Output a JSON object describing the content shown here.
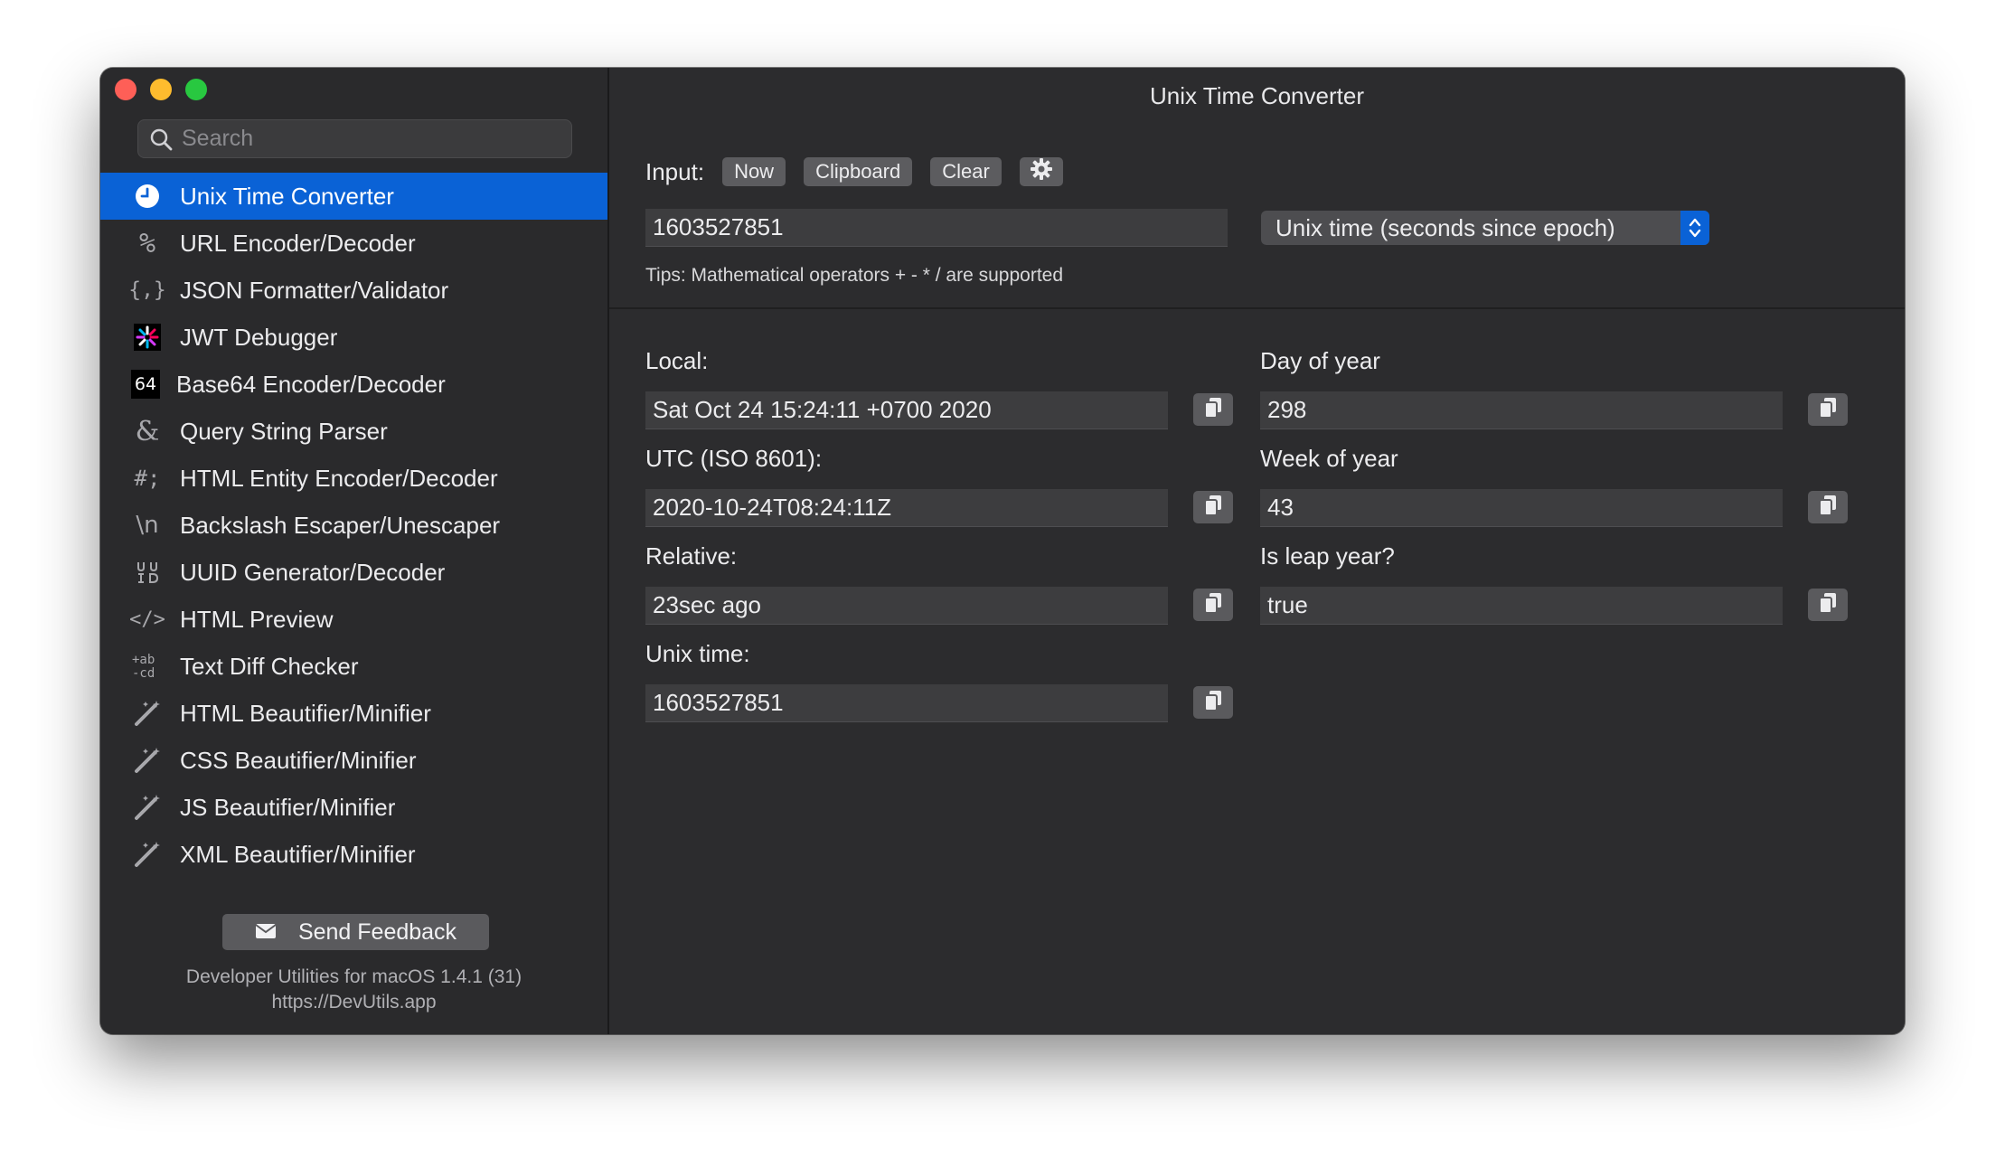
{
  "window": {
    "title": "Unix Time Converter"
  },
  "sidebar": {
    "search_placeholder": "Search",
    "items": [
      {
        "label": "Unix Time Converter",
        "icon": "clock-icon",
        "glyph": ""
      },
      {
        "label": "URL Encoder/Decoder",
        "icon": "percent-icon",
        "glyph": "%"
      },
      {
        "label": "JSON Formatter/Validator",
        "icon": "braces-icon",
        "glyph": "{,}"
      },
      {
        "label": "JWT Debugger",
        "icon": "jwt-icon",
        "glyph": ""
      },
      {
        "label": "Base64 Encoder/Decoder",
        "icon": "base64-icon",
        "glyph": "64"
      },
      {
        "label": "Query String Parser",
        "icon": "ampersand-icon",
        "glyph": "&"
      },
      {
        "label": "HTML Entity Encoder/Decoder",
        "icon": "hash-icon",
        "glyph": "#;"
      },
      {
        "label": "Backslash Escaper/Unescaper",
        "icon": "backslash-n-icon",
        "glyph": "\\n"
      },
      {
        "label": "UUID Generator/Decoder",
        "icon": "uuid-icon",
        "glyph": ""
      },
      {
        "label": "HTML Preview",
        "icon": "code-icon",
        "glyph": "</>"
      },
      {
        "label": "Text Diff Checker",
        "icon": "diff-icon",
        "glyph": ""
      },
      {
        "label": "HTML Beautifier/Minifier",
        "icon": "magic-wand-icon",
        "glyph": ""
      },
      {
        "label": "CSS Beautifier/Minifier",
        "icon": "magic-wand-icon",
        "glyph": ""
      },
      {
        "label": "JS Beautifier/Minifier",
        "icon": "magic-wand-icon",
        "glyph": ""
      },
      {
        "label": "XML Beautifier/Minifier",
        "icon": "magic-wand-icon",
        "glyph": ""
      }
    ],
    "feedback_label": "Send Feedback",
    "version_line1": "Developer Utilities for macOS 1.4.1 (31)",
    "version_line2": "https://DevUtils.app"
  },
  "input": {
    "label": "Input:",
    "buttons": {
      "now": "Now",
      "clipboard": "Clipboard",
      "clear": "Clear"
    },
    "value": "1603527851",
    "format_selected": "Unix time (seconds since epoch)",
    "tips": "Tips: Mathematical operators + - * / are supported"
  },
  "results": {
    "local": {
      "label": "Local:",
      "value": "Sat Oct 24 15:24:11 +0700 2020"
    },
    "utc": {
      "label": "UTC (ISO 8601):",
      "value": "2020-10-24T08:24:11Z"
    },
    "relative": {
      "label": "Relative:",
      "value": "23sec ago"
    },
    "unix": {
      "label": "Unix time:",
      "value": "1603527851"
    },
    "day_of_year": {
      "label": "Day of year",
      "value": "298"
    },
    "week_of_year": {
      "label": "Week of year",
      "value": "43"
    },
    "leap_year": {
      "label": "Is leap year?",
      "value": "true"
    }
  },
  "colors": {
    "accent": "#0a62d6",
    "sidebar_bg": "#2a2a2c",
    "main_bg": "#2c2c2e"
  }
}
